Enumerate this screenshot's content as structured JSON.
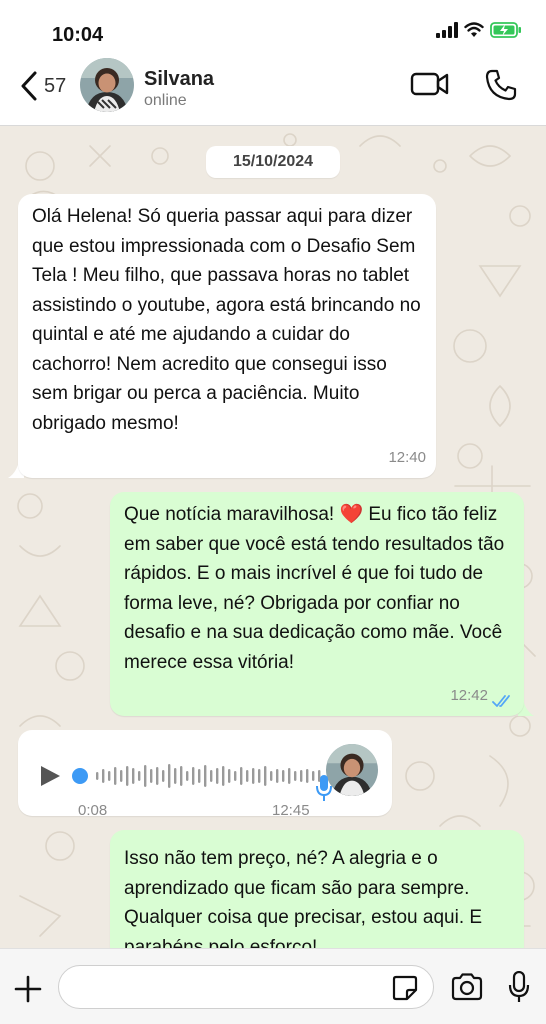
{
  "status_bar": {
    "time": "10:04"
  },
  "header": {
    "back_count": "57",
    "contact_name": "Silvana",
    "contact_status": "online"
  },
  "chat": {
    "date": "15/10/2024",
    "messages": [
      {
        "direction": "incoming",
        "text": "Olá Helena! Só queria passar aqui para dizer que estou impressionada com o Desafio Sem Tela ! Meu filho, que passava horas no tablet assistindo o youtube, agora está brincando no quintal e até me ajudando a cuidar do cachorro! Nem acredito que consegui isso sem brigar ou perca a paciência. Muito obrigado mesmo!",
        "time": "12:40"
      },
      {
        "direction": "outgoing",
        "text": "Que notícia maravilhosa! ❤️ Eu fico tão feliz em saber que você está tendo resultados tão rápidos. E o mais incrível é que foi tudo de forma leve, né? Obrigada por confiar no desafio e na sua dedicação como mãe. Você merece essa vitória!",
        "time": "12:42",
        "status": "read"
      },
      {
        "direction": "incoming",
        "type": "audio",
        "duration": "0:08",
        "time": "12:45",
        "progress": 0
      },
      {
        "direction": "outgoing",
        "text": "Isso não tem preço, né? A alegria e o aprendizado que ficam são para sempre. Qualquer coisa que precisar, estou aqui. E parabéns pelo esforço!"
      }
    ]
  },
  "input": {
    "placeholder": ""
  },
  "colors": {
    "chat_background": "#efeae2",
    "incoming_bubble": "#ffffff",
    "outgoing_bubble": "#d9fdd3",
    "read_ticks": "#53a6f7",
    "battery": "#34c759",
    "heart": "#e0245e"
  },
  "icons": [
    "signal-icon",
    "wifi-icon",
    "battery-charging-icon",
    "back-chevron-icon",
    "video-call-icon",
    "phone-icon",
    "double-check-icon",
    "play-icon",
    "microphone-icon",
    "plus-icon",
    "sticker-icon",
    "camera-icon"
  ]
}
